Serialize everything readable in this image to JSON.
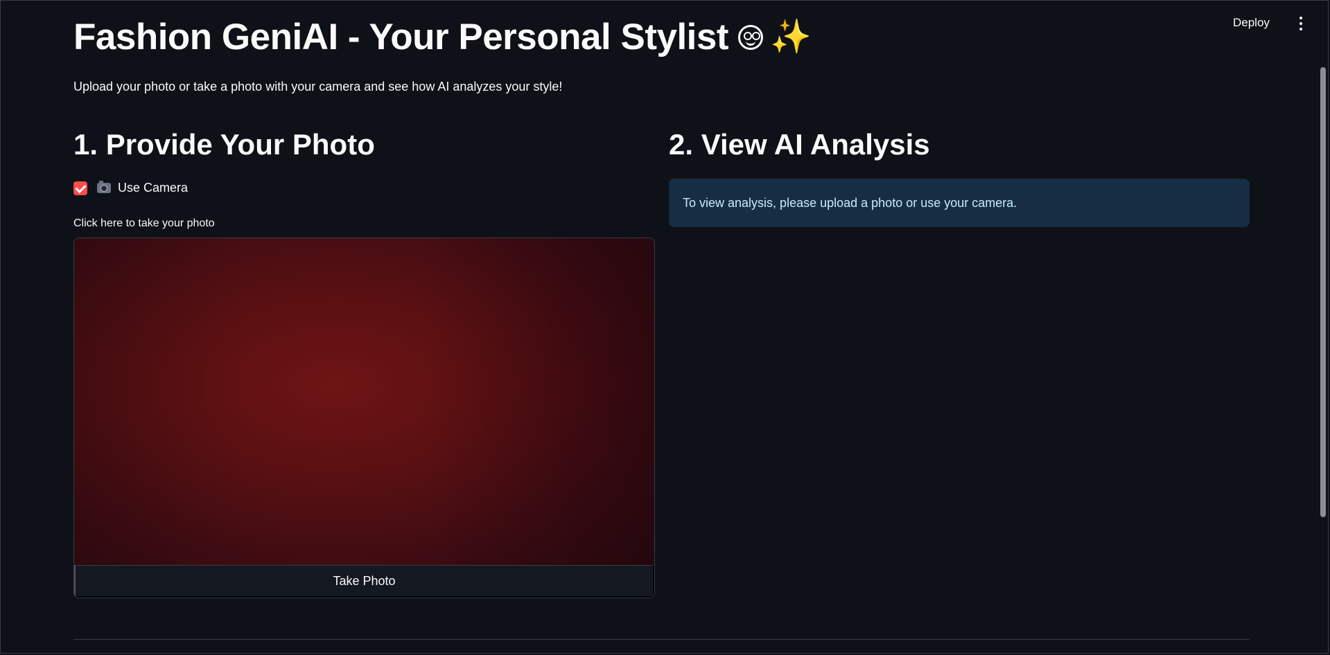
{
  "header": {
    "deploy_label": "Deploy",
    "menu_icon": "kebab-menu-icon"
  },
  "page": {
    "title": "Fashion GeniAI - Your Personal Stylist",
    "title_emojis": "😁✨",
    "subtitle": "Upload your photo or take a photo with your camera and see how AI analyzes your style!"
  },
  "left_column": {
    "heading": "1. Provide Your Photo",
    "use_camera": {
      "label": "Use Camera",
      "icon": "camera-icon",
      "checked": true
    },
    "camera_input": {
      "caption": "Click here to take your photo",
      "button_label": "Take Photo"
    }
  },
  "right_column": {
    "heading": "2. View AI Analysis",
    "info_message": "To view analysis, please upload a photo or use your camera."
  },
  "colors": {
    "background": "#0e1117",
    "accent": "#ff4b4b",
    "info_bg": "#172d43",
    "info_text": "#c7ebff"
  }
}
